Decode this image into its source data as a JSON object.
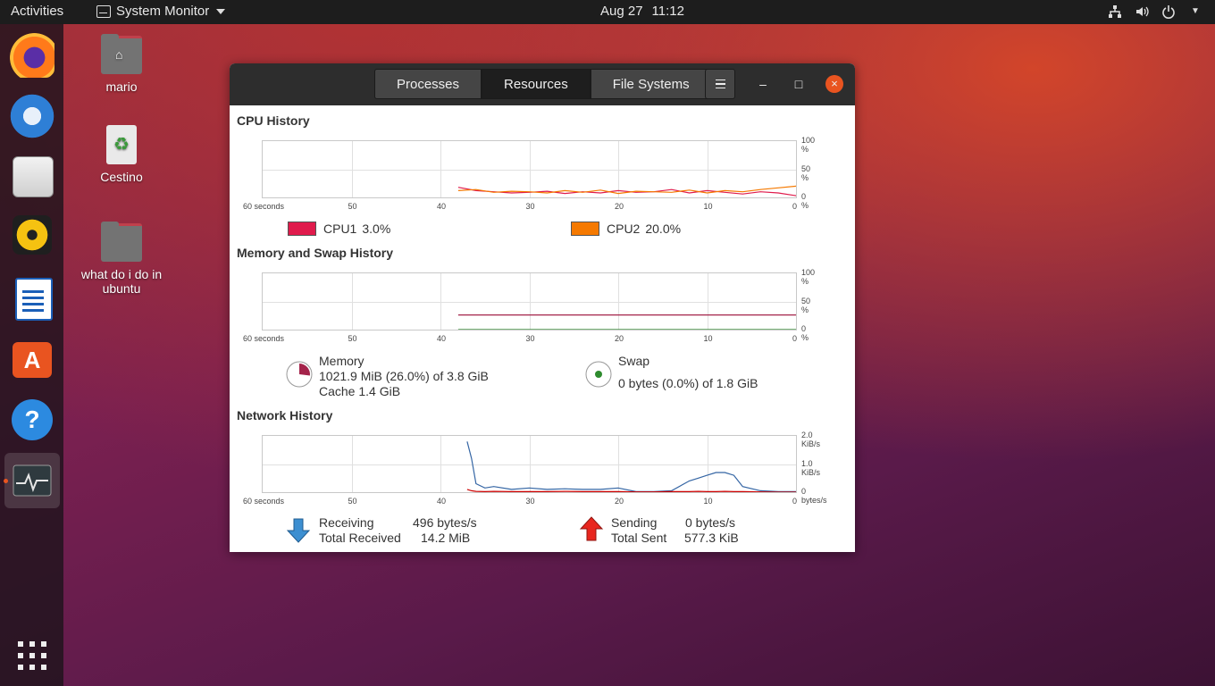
{
  "topbar": {
    "activities": "Activities",
    "app_name": "System Monitor",
    "date": "Aug 27",
    "time": "11:12"
  },
  "dock": {
    "items": [
      "firefox-icon",
      "thunderbird-icon",
      "files-icon",
      "rhythmbox-icon",
      "libreoffice-writer-icon",
      "ubuntu-software-icon",
      "help-icon",
      "system-monitor-icon"
    ],
    "active": "system-monitor-icon"
  },
  "desktop": {
    "icons": [
      {
        "label": "mario"
      },
      {
        "label": "Cestino"
      },
      {
        "label": "what do i do in ubuntu"
      }
    ]
  },
  "window": {
    "tabs": [
      "Processes",
      "Resources",
      "File Systems"
    ],
    "selected_tab": "Resources",
    "minimize": "–",
    "maximize": "□",
    "close": "×"
  },
  "x_axis_ticks": [
    "60 seconds",
    "50",
    "40",
    "30",
    "20",
    "10",
    "0"
  ],
  "cpu": {
    "title": "CPU History",
    "y_ticks": [
      "100 %",
      "50 %",
      "0 %"
    ],
    "legend": [
      {
        "name": "CPU1",
        "value": "3.0%",
        "color": "#e01b4c"
      },
      {
        "name": "CPU2",
        "value": "20.0%",
        "color": "#f57900"
      }
    ]
  },
  "memory": {
    "title": "Memory and Swap History",
    "y_ticks": [
      "100 %",
      "50 %",
      "0 %"
    ],
    "memory_label": "Memory",
    "memory_value": "1021.9 MiB (26.0%) of 3.8 GiB",
    "cache": "Cache 1.4 GiB",
    "swap_label": "Swap",
    "swap_value": "0 bytes (0.0%) of 1.8 GiB",
    "memory_color": "#a4234a",
    "swap_color": "#2e8b2e"
  },
  "network": {
    "title": "Network History",
    "y_ticks": [
      "2.0 KiB/s",
      "1.0 KiB/s",
      "0 bytes/s"
    ],
    "receiving_label": "Receiving",
    "receiving_value": "496 bytes/s",
    "total_received_label": "Total Received",
    "total_received_value": "14.2 MiB",
    "sending_label": "Sending",
    "sending_value": "0 bytes/s",
    "total_sent_label": "Total Sent",
    "total_sent_value": "577.3 KiB",
    "receive_color": "#3465a4",
    "send_color": "#cc0000"
  },
  "chart_data": [
    {
      "type": "line",
      "title": "CPU History",
      "xlabel": "",
      "ylabel": "",
      "x": [
        38,
        36,
        34,
        32,
        30,
        28,
        26,
        24,
        22,
        20,
        18,
        16,
        14,
        12,
        10,
        8,
        6,
        4,
        2,
        0
      ],
      "xlim": [
        60,
        0
      ],
      "ylim": [
        0,
        100
      ],
      "series": [
        {
          "name": "CPU1",
          "values": [
            18,
            12,
            10,
            8,
            9,
            11,
            7,
            10,
            8,
            12,
            9,
            10,
            14,
            8,
            12,
            9,
            6,
            10,
            8,
            3
          ]
        },
        {
          "name": "CPU2",
          "values": [
            12,
            14,
            9,
            11,
            10,
            8,
            12,
            9,
            13,
            7,
            11,
            10,
            9,
            13,
            8,
            12,
            10,
            14,
            17,
            20
          ]
        }
      ]
    },
    {
      "type": "line",
      "title": "Memory and Swap History",
      "xlabel": "",
      "ylabel": "",
      "x": [
        38,
        0
      ],
      "xlim": [
        60,
        0
      ],
      "ylim": [
        0,
        100
      ],
      "series": [
        {
          "name": "Memory",
          "values": [
            26,
            26
          ]
        },
        {
          "name": "Swap",
          "values": [
            0,
            0
          ]
        }
      ]
    },
    {
      "type": "line",
      "title": "Network History",
      "xlabel": "",
      "ylabel": "",
      "x": [
        37,
        36.5,
        36,
        35,
        34,
        32,
        30,
        28,
        26,
        24,
        22,
        20,
        18,
        16,
        14,
        12,
        11,
        10,
        9,
        8,
        7,
        6,
        4,
        2,
        0
      ],
      "xlim": [
        60,
        0
      ],
      "ylim": [
        0,
        2.0
      ],
      "series": [
        {
          "name": "Receiving",
          "values": [
            1.8,
            1.2,
            0.3,
            0.15,
            0.2,
            0.1,
            0.15,
            0.1,
            0.12,
            0.1,
            0.1,
            0.15,
            0.02,
            0.02,
            0.05,
            0.4,
            0.5,
            0.6,
            0.7,
            0.7,
            0.6,
            0.2,
            0.05,
            0.02,
            0.02
          ]
        },
        {
          "name": "Sending",
          "values": [
            0.1,
            0.05,
            0.03,
            0.02,
            0.03,
            0.02,
            0.02,
            0.02,
            0.03,
            0.02,
            0.02,
            0.02,
            0.01,
            0.01,
            0.02,
            0.02,
            0.03,
            0.02,
            0.02,
            0.03,
            0.02,
            0.02,
            0.01,
            0.0,
            0.0
          ]
        }
      ]
    }
  ]
}
